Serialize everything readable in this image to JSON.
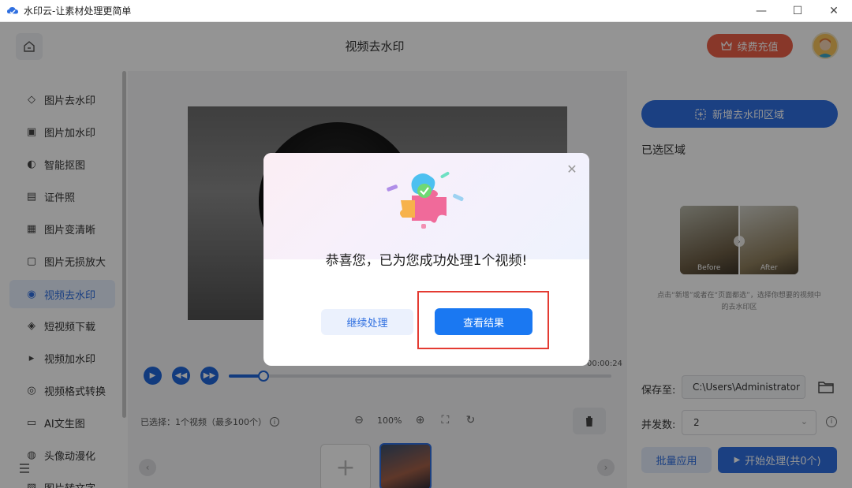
{
  "window": {
    "title": "水印云-让素材处理更简单",
    "controls": [
      "—",
      "☐",
      "✕"
    ]
  },
  "header": {
    "page_title": "视频去水印",
    "vip_label": "续费充值"
  },
  "sidebar": {
    "items": [
      {
        "label": "图片去水印",
        "icon": "eraser-icon"
      },
      {
        "label": "图片加水印",
        "icon": "image-add-icon"
      },
      {
        "label": "智能抠图",
        "icon": "cutout-icon"
      },
      {
        "label": "证件照",
        "icon": "id-card-icon"
      },
      {
        "label": "图片变清晰",
        "icon": "hd-icon"
      },
      {
        "label": "图片无损放大",
        "icon": "enlarge-icon"
      },
      {
        "label": "视频去水印",
        "icon": "video-eraser-icon",
        "active": true
      },
      {
        "label": "短视频下载",
        "icon": "download-icon"
      },
      {
        "label": "视频加水印",
        "icon": "video-add-icon"
      },
      {
        "label": "视频格式转换",
        "icon": "convert-icon"
      },
      {
        "label": "AI文生图",
        "icon": "ai-icon"
      },
      {
        "label": "头像动漫化",
        "icon": "anime-icon"
      },
      {
        "label": "图片转文字",
        "icon": "ocr-icon"
      }
    ]
  },
  "player": {
    "time": "00:00:24",
    "progress": 0.09
  },
  "status": {
    "selected": "已选择：1个视频（最多100个）",
    "zoom": "100%"
  },
  "right_panel": {
    "add_area_label": "新增去水印区域",
    "selected_area_label": "已选区域",
    "before_label": "Before",
    "after_label": "After",
    "hint": "点击“新增”或者在“页面都选”，选择你想要的视频中的去水印区",
    "save_label": "保存至:",
    "save_path": "C:\\Users\\Administrator",
    "concurrency_label": "并发数:",
    "concurrency_value": "2",
    "batch_label": "批量应用",
    "start_label": "开始处理(共0个)"
  },
  "modal": {
    "message": "恭喜您，已为您成功处理1个视频!",
    "continue_label": "继续处理",
    "view_label": "查看结果"
  },
  "colors": {
    "accent": "#2f6fe0",
    "vip": "#ea6047",
    "highlight": "#e43b32"
  }
}
